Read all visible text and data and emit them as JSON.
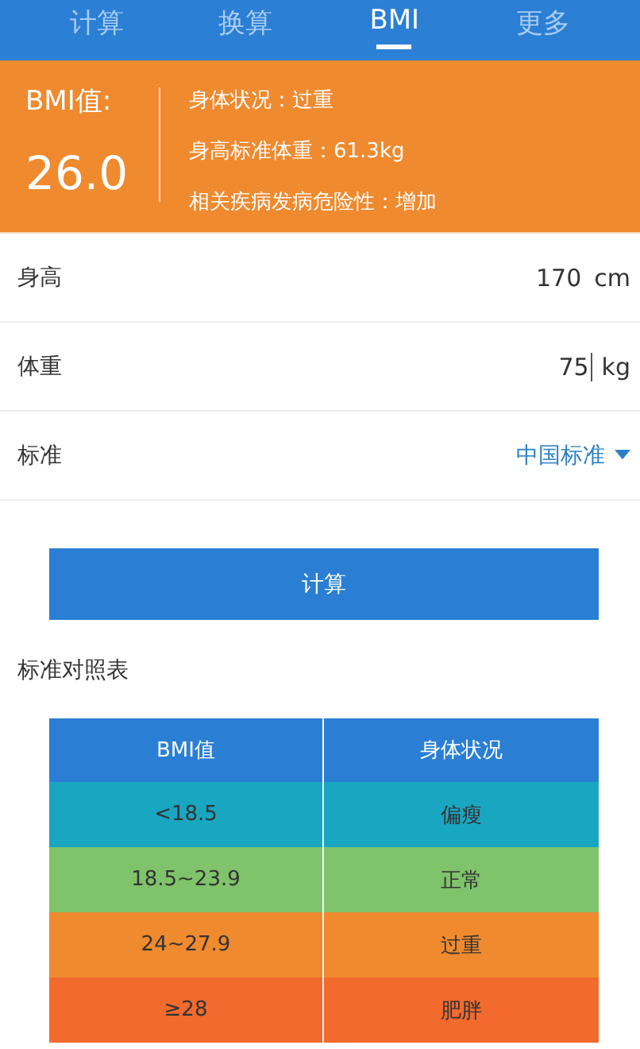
{
  "tabs": [
    {
      "label": "计算",
      "selected": false
    },
    {
      "label": "换算",
      "selected": false
    },
    {
      "label": "BMI",
      "selected": true
    },
    {
      "label": "更多",
      "selected": false
    }
  ],
  "summary": {
    "bmi_label": "BMI值:",
    "bmi_value": "26.0",
    "details": [
      "身体状况：过重",
      "身高标准体重：61.3kg",
      "相关疾病发病危险性：增加"
    ]
  },
  "fields": [
    {
      "kind": "input",
      "label": "身高",
      "value": "170",
      "unit": "cm",
      "focused": false
    },
    {
      "kind": "input",
      "label": "体重",
      "value": "75",
      "unit": "kg",
      "focused": true
    },
    {
      "kind": "select",
      "label": "标准",
      "value": "中国标准"
    }
  ],
  "calculate_button": "计算",
  "table_title": "标准对照表",
  "table": {
    "columns": [
      "BMI值",
      "身体状况"
    ],
    "rows": [
      {
        "color": "#19a6c0",
        "cells": [
          "<18.5",
          "偏瘦"
        ]
      },
      {
        "color": "#7fc36b",
        "cells": [
          "18.5~23.9",
          "正常"
        ]
      },
      {
        "color": "#ef8a2e",
        "cells": [
          "24~27.9",
          "过重"
        ]
      },
      {
        "color": "#f26a2d",
        "cells": [
          "≥28",
          "肥胖"
        ]
      }
    ]
  }
}
